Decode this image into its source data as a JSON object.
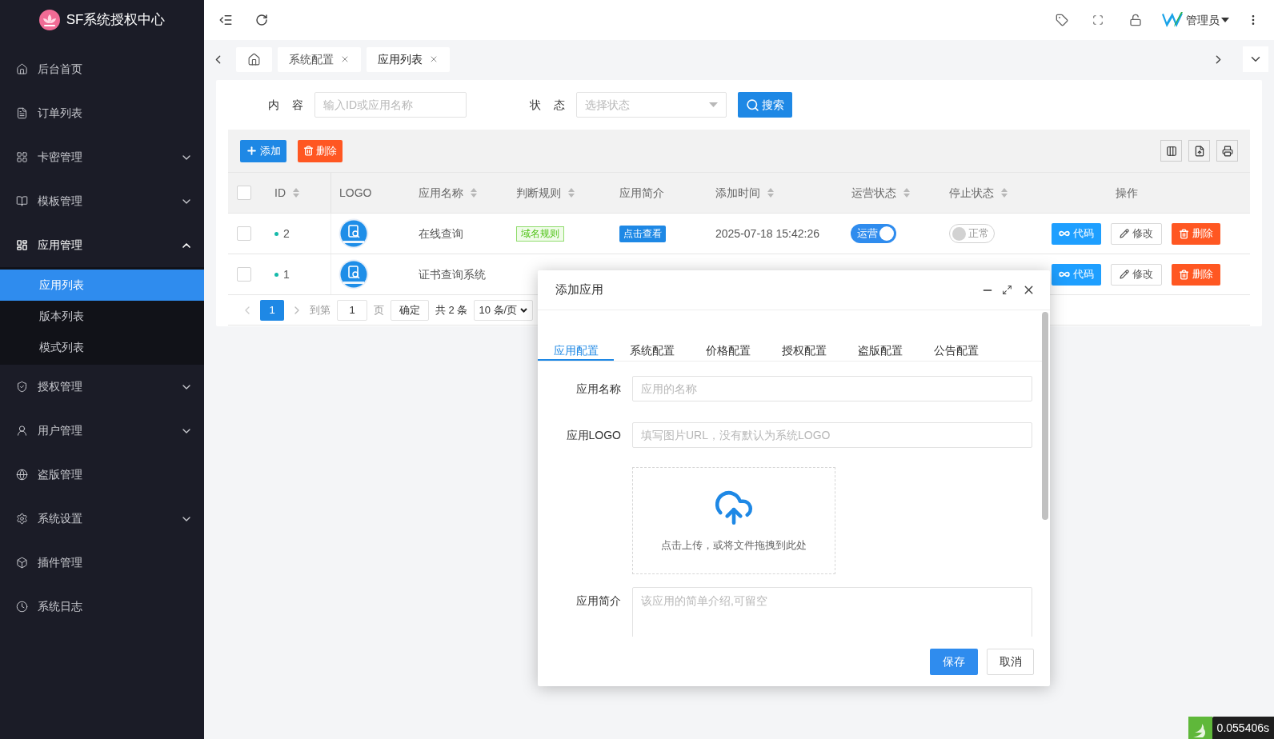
{
  "sidebar": {
    "brand": "SF系统授权中心",
    "items": [
      {
        "label": "后台首页",
        "kind": "link"
      },
      {
        "label": "订单列表",
        "kind": "link"
      },
      {
        "label": "卡密管理",
        "kind": "group",
        "expanded": false
      },
      {
        "label": "模板管理",
        "kind": "group",
        "expanded": false
      },
      {
        "label": "应用管理",
        "kind": "group",
        "expanded": true,
        "children": [
          {
            "label": "应用列表",
            "selected": true
          },
          {
            "label": "版本列表",
            "selected": false
          },
          {
            "label": "模式列表",
            "selected": false
          }
        ]
      },
      {
        "label": "授权管理",
        "kind": "group",
        "expanded": false
      },
      {
        "label": "用户管理",
        "kind": "group",
        "expanded": false
      },
      {
        "label": "盗版管理",
        "kind": "link"
      },
      {
        "label": "系统设置",
        "kind": "group",
        "expanded": false
      },
      {
        "label": "插件管理",
        "kind": "link"
      },
      {
        "label": "系统日志",
        "kind": "link"
      }
    ]
  },
  "header": {
    "user": "管理员"
  },
  "page_tabs": [
    {
      "label": "系统配置",
      "selected": false
    },
    {
      "label": "应用列表",
      "selected": true
    }
  ],
  "search": {
    "fields": [
      {
        "label": "内 容",
        "placeholder": "输入ID或应用名称",
        "kind": "input"
      },
      {
        "label": "状 态",
        "placeholder": "选择状态",
        "kind": "select"
      }
    ],
    "button": "搜索"
  },
  "toolbar": {
    "buttons": [
      {
        "label": "添加",
        "kind": "primary"
      },
      {
        "label": "删除",
        "kind": "danger"
      }
    ]
  },
  "table": {
    "all_checked": false,
    "columns": [
      {
        "label": "ID",
        "sortable": true
      },
      {
        "label": "LOGO",
        "sortable": false
      },
      {
        "label": "应用名称",
        "sortable": true
      },
      {
        "label": "判断规则",
        "sortable": true
      },
      {
        "label": "应用简介",
        "sortable": false
      },
      {
        "label": "添加时间",
        "sortable": true
      },
      {
        "label": "运营状态",
        "sortable": true
      },
      {
        "label": "停止状态",
        "sortable": true
      },
      {
        "label": "操作",
        "sortable": false
      }
    ],
    "rows": [
      {
        "checked": false,
        "id": "2",
        "name": "在线查询",
        "rule": "域名规则",
        "intro": "点击查看",
        "time": "2025-07-18 15:42:26",
        "running": {
          "on": true,
          "label": "运营"
        },
        "stopped": {
          "on": false,
          "label": "正常"
        },
        "actions": [
          {
            "label": "代码",
            "kind": "code"
          },
          {
            "label": "修改",
            "kind": "edit"
          },
          {
            "label": "删除",
            "kind": "delete"
          }
        ]
      },
      {
        "checked": false,
        "id": "1",
        "name": "证书查询系统",
        "actions": [
          {
            "label": "代码",
            "kind": "code"
          },
          {
            "label": "修改",
            "kind": "edit"
          },
          {
            "label": "删除",
            "kind": "delete"
          }
        ]
      }
    ]
  },
  "pagination": {
    "pages": [
      {
        "label": "1",
        "selected": true
      }
    ],
    "goto_label": "到第",
    "goto_value": "1",
    "page_unit": "页",
    "confirm": "确定",
    "total": "共 2 条",
    "page_size": "10 条/页"
  },
  "dialog": {
    "title": "添加应用",
    "tabs": [
      {
        "label": "应用配置",
        "selected": true
      },
      {
        "label": "系统配置",
        "selected": false
      },
      {
        "label": "价格配置",
        "selected": false
      },
      {
        "label": "授权配置",
        "selected": false
      },
      {
        "label": "盗版配置",
        "selected": false
      },
      {
        "label": "公告配置",
        "selected": false
      }
    ],
    "fields": [
      {
        "kind": "input",
        "label": "应用名称",
        "placeholder": "应用的名称"
      },
      {
        "kind": "input",
        "label": "应用LOGO",
        "placeholder": "填写图片URL，没有默认为系统LOGO"
      },
      {
        "kind": "upload",
        "text": "点击上传，或将文件拖拽到此处"
      },
      {
        "kind": "textarea",
        "label": "应用简介",
        "placeholder": "该应用的简单介绍,可留空"
      }
    ],
    "buttons": [
      {
        "label": "保存",
        "kind": "primary"
      },
      {
        "label": "取消",
        "kind": "default"
      }
    ]
  },
  "timer": "0.055406s"
}
